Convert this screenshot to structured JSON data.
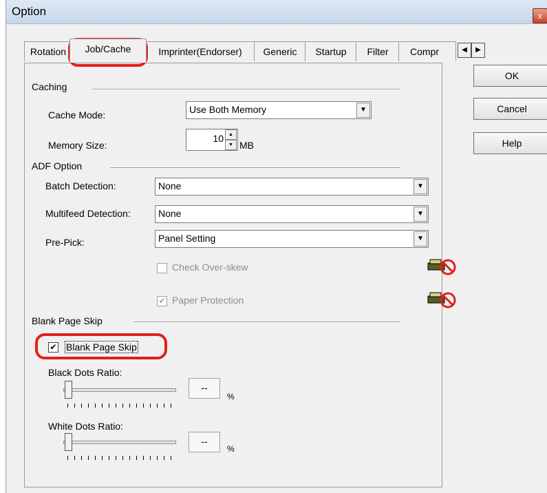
{
  "window": {
    "title": "Option",
    "close_glyph": "x"
  },
  "tabs": [
    {
      "label": "Rotation"
    },
    {
      "label": "Job/Cache"
    },
    {
      "label": "Imprinter(Endorser)"
    },
    {
      "label": "Generic"
    },
    {
      "label": "Startup"
    },
    {
      "label": "Filter"
    },
    {
      "label": "Compr"
    }
  ],
  "tab_scroll": {
    "left_glyph": "◀",
    "right_glyph": "▶"
  },
  "buttons": {
    "ok": "OK",
    "cancel": "Cancel",
    "help": "Help"
  },
  "caching": {
    "group_label": "Caching",
    "cache_mode_label": "Cache Mode:",
    "cache_mode_value": "Use Both Memory",
    "memory_size_label": "Memory Size:",
    "memory_size_value": "10",
    "memory_unit": "MB"
  },
  "adf": {
    "group_label": "ADF Option",
    "batch_label": "Batch Detection:",
    "batch_value": "None",
    "multifeed_label": "Multifeed Detection:",
    "multifeed_value": "None",
    "prepick_label": "Pre-Pick:",
    "prepick_value": "Panel Setting",
    "check_overskew_label": "Check Over-skew",
    "check_overskew_checked": false,
    "paper_protection_label": "Paper Protection",
    "paper_protection_checked": true
  },
  "blank": {
    "group_label": "Blank Page Skip",
    "checkbox_label": "Blank Page Skip",
    "checkbox_checked": true,
    "black_label": "Black Dots Ratio:",
    "black_value": "--",
    "white_label": "White Dots Ratio:",
    "white_value": "--",
    "unit": "%"
  },
  "icons": {
    "not_supported": "scanner-not-supported-icon",
    "dropdown": "dropdown-arrow-icon"
  },
  "colors": {
    "highlight_ring": "#e0211d",
    "title_bar": "#c6d6ea"
  }
}
